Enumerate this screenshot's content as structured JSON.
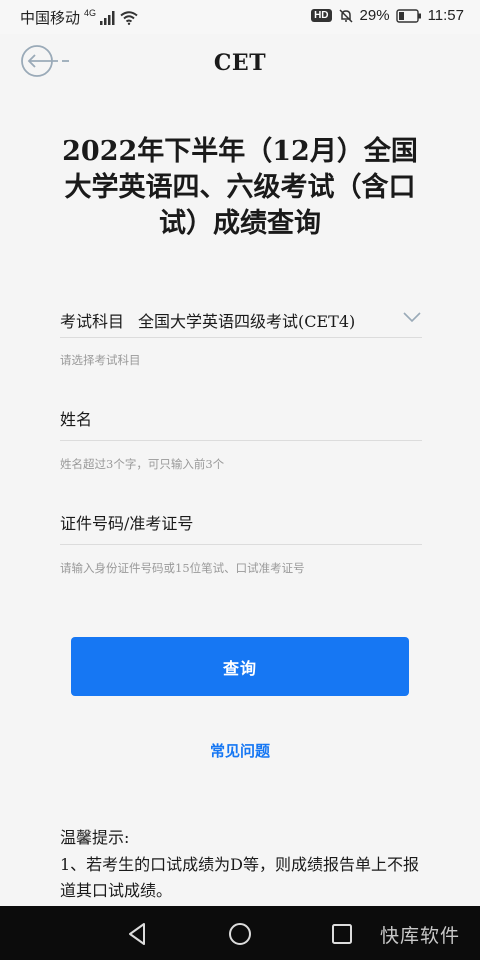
{
  "status_bar": {
    "carrier": "中国移动",
    "network": "4G",
    "battery": "29%",
    "time": "11:57",
    "hd_label": "HD"
  },
  "header": {
    "title": "CET",
    "back_icon": "back-arrow-icon"
  },
  "heading": "2022年下半年（12月）全国大学英语四、六级考试（含口试）成绩查询",
  "form": {
    "subject": {
      "label": "考试科目",
      "value": "全国大学英语四级考试(CET4)",
      "hint": "请选择考试科目"
    },
    "name": {
      "label": "姓名",
      "hint": "姓名超过3个字，可只输入前3个"
    },
    "id": {
      "label": "证件号码/准考证号",
      "hint": "请输入身份证件号码或15位笔试、口试准考证号"
    }
  },
  "query_button": "查询",
  "faq_link": "常见问题",
  "tips": {
    "title": "温馨提示:",
    "item1": "1、若考生的口试成绩为D等，则成绩报告单上不报道其口试成绩。"
  },
  "nav": {
    "watermark": "快库软件"
  },
  "colors": {
    "accent": "#1677f3",
    "background": "#f5f5f5"
  }
}
